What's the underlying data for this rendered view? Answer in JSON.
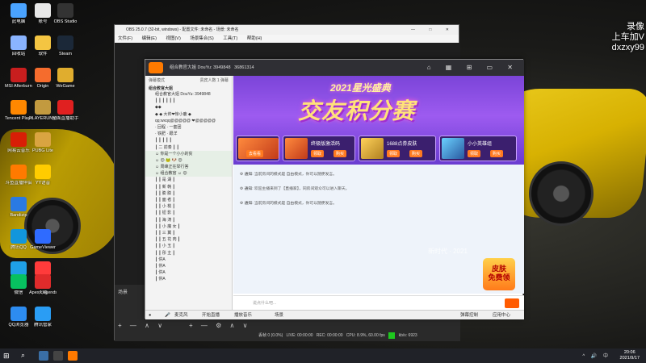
{
  "desktop": {
    "icons": [
      {
        "label": "此电脑",
        "color": "#4aa3ff"
      },
      {
        "label": "账号",
        "color": "#e8e8e8"
      },
      {
        "label": "OBS Studio",
        "color": "#333333"
      },
      {
        "label": "回收站",
        "color": "#8ab4ff"
      },
      {
        "label": "软件",
        "color": "#f4c542"
      },
      {
        "label": "Steam",
        "color": "#1b2838"
      },
      {
        "label": "MSI Afterburner",
        "color": "#c81e1e"
      },
      {
        "label": "Origin",
        "color": "#f56c2d"
      },
      {
        "label": "WeGame",
        "color": "#e0ad2e"
      },
      {
        "label": "Tencent Player",
        "color": "#ff8800"
      },
      {
        "label": "PLAYERUNKNOWN'S BATTLEGROUNDS",
        "color": "#c29a3f"
      },
      {
        "label": "全面直播助手",
        "color": "#e02020"
      },
      {
        "label": "网易云音乐",
        "color": "#d81e06"
      },
      {
        "label": "PUBG Lite",
        "color": "#d9a441"
      },
      {
        "label": "斗鱼直播伴侣",
        "color": "#ff7a00"
      },
      {
        "label": "YY语音",
        "color": "#ffcc00"
      },
      {
        "label": "Bandizip",
        "color": "#2a7ae2"
      },
      {
        "label": "腾讯QQ",
        "color": "#1296db"
      },
      {
        "label": "GameViewer",
        "color": "#2f6bff"
      },
      {
        "label": "加速器",
        "color": "#1fa0e6"
      },
      {
        "label": "迅雷",
        "color": "#ff3b3b"
      },
      {
        "label": "Apex Legends",
        "color": "#b5382b"
      },
      {
        "label": "微信",
        "color": "#07c160"
      },
      {
        "label": "火绒",
        "color": "#e02b2b"
      },
      {
        "label": "QQ浏览器",
        "color": "#2d8cf0"
      },
      {
        "label": "腾讯管家",
        "color": "#2a9df4"
      }
    ]
  },
  "overlay": {
    "line1": "录像",
    "line2": "上车加V",
    "line3": "dxzxy99"
  },
  "obs": {
    "title": "OBS 25.0.7 (32-bit, windows) - 配置文件: 未命名 - 场景: 未命名",
    "menu": [
      "文件(F)",
      "编辑(E)",
      "视图(V)",
      "场景集合(S)",
      "工具(T)",
      "帮助(H)"
    ],
    "window_buttons": "— □ ✕",
    "scene_label": "场景",
    "controls": "+ — ∧ ∨",
    "controls2": "+ — ⚙ ∧ ∨",
    "status": {
      "dropped": "丢帧 0 (0.0%)",
      "live": "LIVE: 00:00:00",
      "rec": "REC: 00:00:00",
      "cpu": "CPU: 8.9%, 60.00 fps",
      "kbps": "kb/s: 6923"
    }
  },
  "douyu": {
    "room_title": "组合教官大姐 DouYu: 3949848",
    "room_id": "3949848",
    "viewers": "36861314",
    "sidebar": {
      "tabs": "弹幕模式",
      "tabs_right": "贵宾人数 1 弹幕",
      "header": "组合教官大姐",
      "rows": [
        "组合教官大姐   DouYu: 3949848",
        "  ┃  ┃  ┃  ┃  ┃  ┃",
        "         ◆◆",
        "  ◆  ◆ 大帅❤惊小鹿 ◆",
        "  qq:wxqq@@@@@ ❤@@@@@",
        "     · 回程 · 一套团",
        "     · 铁肥 · 跟洋",
        "  ┃  ┃  ┃  ┃  ┃",
        "  ┃ 二 前奏 ┃  ┃",
        "  ☺ 你是一个小小的贫",
        "  ☺ 😊 🐸 🐶 😊",
        "  ☺ 周峰正在举行答",
        "  ☺ 组合教官 ☺ 😊",
        "  ┃  ┃ 是 湖 ┃",
        "  ┃  ┃ 新 韩 ┃",
        "  ┃  ┃ 膨 膨 ┃",
        "  ┃  ┃ 面 者 ┃",
        "  ┃  ┃ 小 桃 ┃",
        "  ┃  ┃ 钮 影 ┃",
        "  ┃  ┃ 海 涛 ┃",
        "  ┃  ┃ 小 魔 女 ┃",
        "  ┃  ┃ 三 翼 ┃",
        "  ┃  ┃ 五 花 肉 ┃",
        "  ┃  ┃ 小 玉 ┃",
        "  ┃  ┃ 彤 主 ┃",
        "  ┃ 供A",
        "  ┃ 供A",
        "  ┃ 供A",
        "  ┃ 供A"
      ]
    },
    "banner": {
      "year": "2021星光盛典",
      "title": "交友积分赛",
      "cards": [
        {
          "title": "幸运福利",
          "btn": "去看看"
        },
        {
          "title": "终极版激活码",
          "btn": "领取",
          "btn2": "购买"
        },
        {
          "title": "1688点券皮肤",
          "btn": "领取",
          "btn2": "购买"
        },
        {
          "title": "小小英雄组",
          "btn": "领取",
          "btn2": "购买"
        }
      ]
    },
    "chat": [
      {
        "prefix": "通知:",
        "text": "当前房间的模式是 自由模式，你可以随便发言。"
      },
      {
        "prefix": "通知:",
        "text": "欢迎主播来到了【直播家】，同房间观众可以进入聊天。"
      },
      {
        "prefix": "通知:",
        "text": "当前房间的模式是 自由模式，你可以随便发言。"
      }
    ],
    "overlay_text": "新时代 · 2021",
    "input_placeholder": "说点什么吧...",
    "tools": {
      "mic": "麦克风",
      "gift": "礼物",
      "open_live": "开始直播",
      "music": "播放音乐",
      "scene": "场景",
      "tools_label": "弹幕控制",
      "app": "应用中心"
    },
    "promo": {
      "line1": "皮肤",
      "line2": "免费领"
    }
  },
  "taskbar": {
    "tray": "^ 🔊 中",
    "time": "20:06",
    "date": "2021/9/17"
  }
}
